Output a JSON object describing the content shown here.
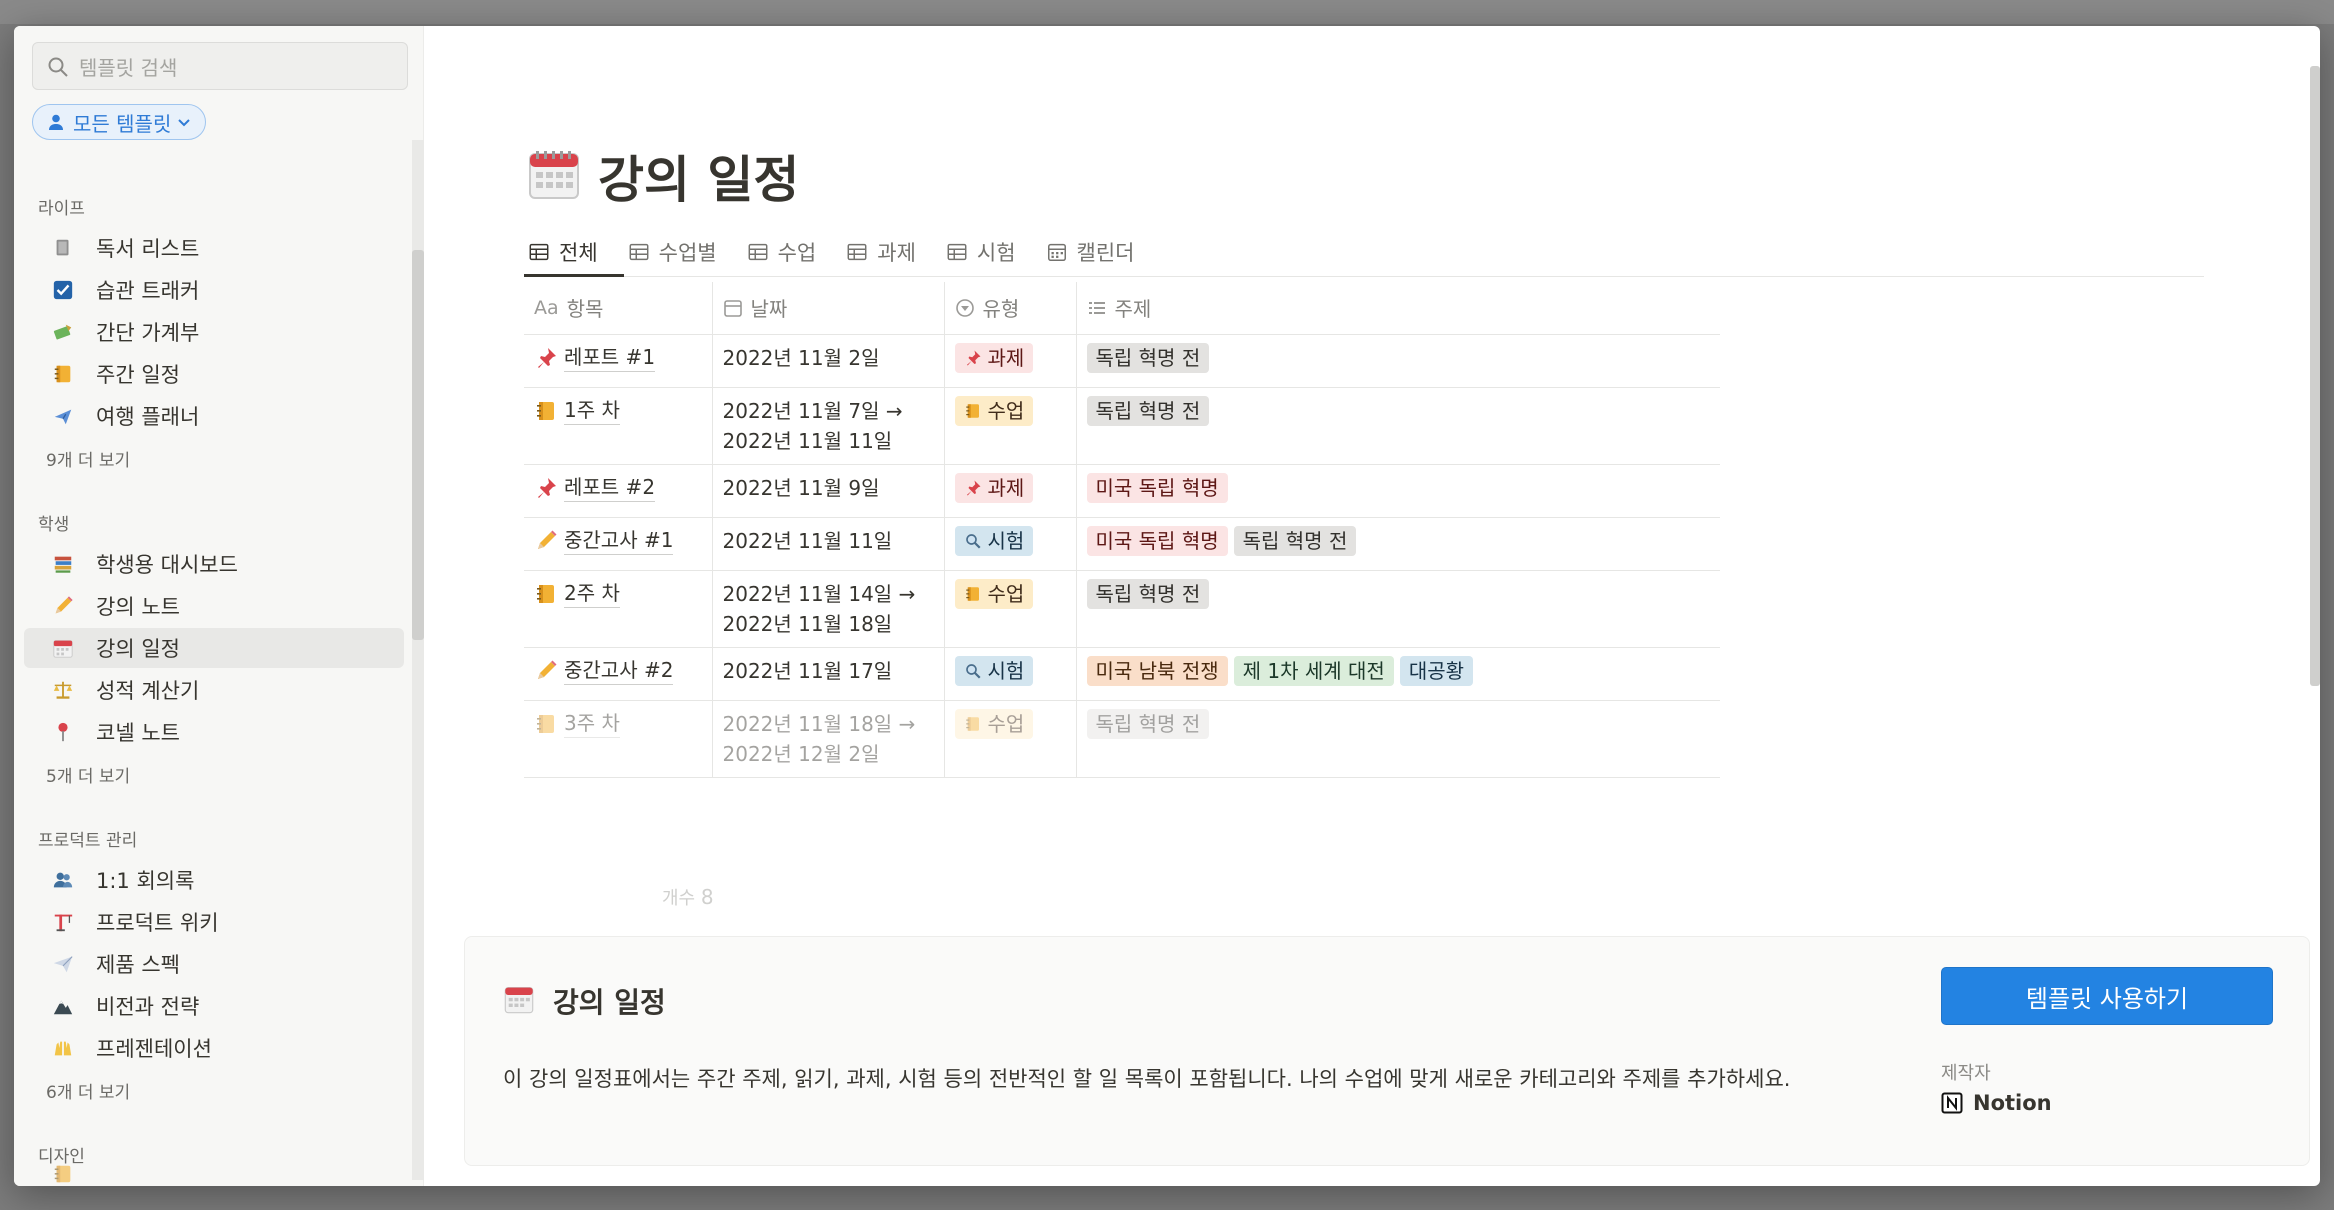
{
  "sidebar": {
    "search_placeholder": "템플릿 검색",
    "filter_label": "모든 템플릿",
    "sections": [
      {
        "title": "라이프",
        "items": [
          {
            "label": "독서 리스트",
            "icon": "book-icon"
          },
          {
            "label": "습관 트래커",
            "icon": "checkbox-icon"
          },
          {
            "label": "간단 가계부",
            "icon": "money-icon"
          },
          {
            "label": "주간 일정",
            "icon": "notebook-icon"
          },
          {
            "label": "여행 플래너",
            "icon": "airplane-icon"
          }
        ],
        "more": "9개 더 보기"
      },
      {
        "title": "학생",
        "items": [
          {
            "label": "학생용 대시보드",
            "icon": "books-icon"
          },
          {
            "label": "강의 노트",
            "icon": "pencil-icon"
          },
          {
            "label": "강의 일정",
            "icon": "calendar-icon"
          },
          {
            "label": "성적 계산기",
            "icon": "scales-icon"
          },
          {
            "label": "코넬 노트",
            "icon": "pin-icon"
          }
        ],
        "more": "5개 더 보기"
      },
      {
        "title": "프로덕트 관리",
        "items": [
          {
            "label": "1:1 회의록",
            "icon": "people-icon"
          },
          {
            "label": "프로덕트 위키",
            "icon": "crane-icon"
          },
          {
            "label": "제품 스펙",
            "icon": "paper-plane-icon"
          },
          {
            "label": "비전과 전략",
            "icon": "mountain-icon"
          },
          {
            "label": "프레젠테이션",
            "icon": "raised-hands-icon"
          }
        ],
        "more": "6개 더 보기"
      },
      {
        "title": "디자인",
        "items": [],
        "more": ""
      }
    ]
  },
  "page": {
    "title": "강의 일정",
    "tabs": [
      "전체",
      "수업별",
      "수업",
      "과제",
      "시험",
      "캘린더"
    ],
    "columns": [
      "항목",
      "날짜",
      "유형",
      "주제"
    ],
    "rows": [
      {
        "name": "레포트 #1",
        "icon": "pushpin-icon",
        "date": "2022년 11월 2일",
        "type": "과제",
        "type_icon": "pushpin-icon",
        "type_color": "red",
        "topics": [
          {
            "label": "독립 혁명 전",
            "color": "gray"
          }
        ]
      },
      {
        "name": "1주 차",
        "icon": "notebook-icon",
        "date": "2022년 11월 7일 → 2022년 11월 11일",
        "type": "수업",
        "type_icon": "notebook-icon",
        "type_color": "yellow",
        "topics": [
          {
            "label": "독립 혁명 전",
            "color": "gray"
          }
        ]
      },
      {
        "name": "레포트 #2",
        "icon": "pushpin-icon",
        "date": "2022년 11월 9일",
        "type": "과제",
        "type_icon": "pushpin-icon",
        "type_color": "red",
        "topics": [
          {
            "label": "미국 독립 혁명",
            "color": "red"
          }
        ]
      },
      {
        "name": "중간고사 #1",
        "icon": "pencil-icon",
        "date": "2022년 11월 11일",
        "type": "시험",
        "type_icon": "magnifier-icon",
        "type_color": "blue",
        "topics": [
          {
            "label": "미국 독립 혁명",
            "color": "red"
          },
          {
            "label": "독립 혁명 전",
            "color": "gray"
          }
        ]
      },
      {
        "name": "2주 차",
        "icon": "notebook-icon",
        "date": "2022년 11월 14일 → 2022년 11월 18일",
        "type": "수업",
        "type_icon": "notebook-icon",
        "type_color": "yellow",
        "topics": [
          {
            "label": "독립 혁명 전",
            "color": "gray"
          }
        ]
      },
      {
        "name": "중간고사 #2",
        "icon": "pencil-icon",
        "date": "2022년 11월 17일",
        "type": "시험",
        "type_icon": "magnifier-icon",
        "type_color": "blue",
        "topics": [
          {
            "label": "미국 남북 전쟁",
            "color": "orange"
          },
          {
            "label": "제 1차 세계 대전",
            "color": "green"
          },
          {
            "label": "대공황",
            "color": "blue"
          }
        ]
      },
      {
        "name": "3주 차",
        "icon": "notebook-icon",
        "date": "2022년 11월 18일 → 2022년 12월 2일",
        "type": "수업",
        "type_icon": "notebook-icon",
        "type_color": "yellow",
        "topics": [
          {
            "label": "독립 혁명 전",
            "color": "gray"
          }
        ],
        "faded": true
      }
    ],
    "count_label": "개수",
    "count_value": "8"
  },
  "panel": {
    "title": "강의 일정",
    "description": "이 강의 일정표에서는 주간 주제, 읽기, 과제, 시험 등의 전반적인 할 일 목록이 포함됩니다. 나의 수업에 맞게 새로운 카테고리와 주제를 추가하세요.",
    "use_button": "템플릿 사용하기",
    "maker_label": "제작자",
    "maker": "Notion"
  }
}
